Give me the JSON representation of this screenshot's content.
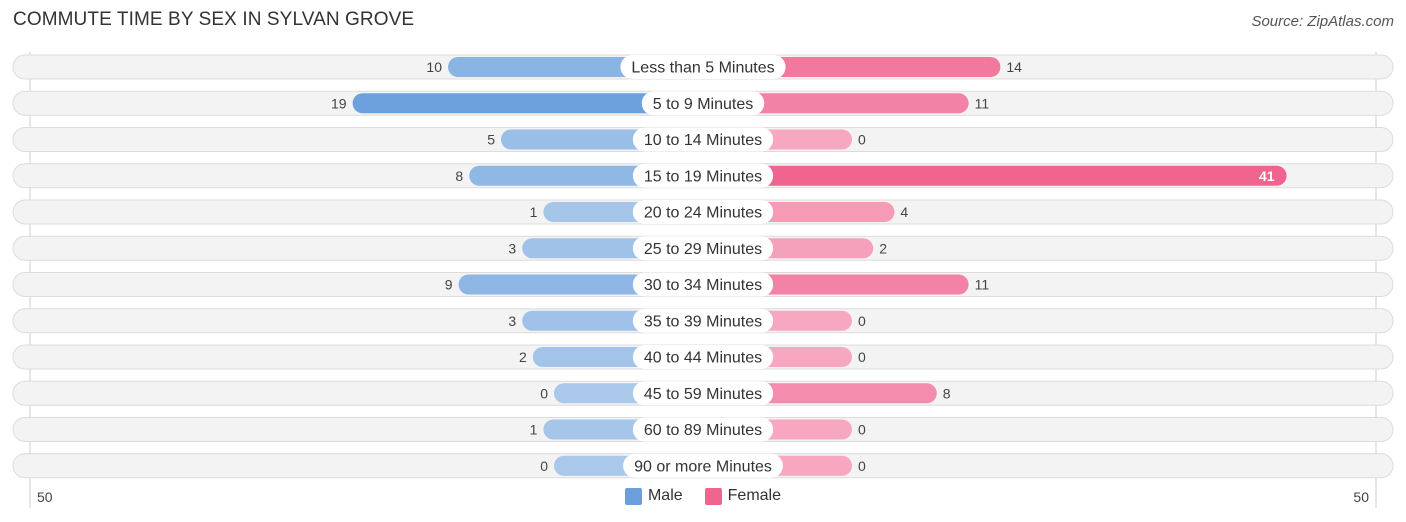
{
  "header": {
    "title": "COMMUTE TIME BY SEX IN SYLVAN GROVE",
    "source": "Source: ZipAtlas.com"
  },
  "colors": {
    "male": "#6a9fdc",
    "male_light": "#a9c8ea",
    "female": "#f06590",
    "female_light": "#f7a8c0"
  },
  "legend": [
    {
      "name": "Male",
      "color": "#6a9fdc"
    },
    {
      "name": "Female",
      "color": "#f06590"
    }
  ],
  "chart_data": {
    "type": "bar",
    "orientation": "horizontal-diverging",
    "title": "COMMUTE TIME BY SEX IN SYLVAN GROVE",
    "categories": [
      "Less than 5 Minutes",
      "5 to 9 Minutes",
      "10 to 14 Minutes",
      "15 to 19 Minutes",
      "20 to 24 Minutes",
      "25 to 29 Minutes",
      "30 to 34 Minutes",
      "35 to 39 Minutes",
      "40 to 44 Minutes",
      "45 to 59 Minutes",
      "60 to 89 Minutes",
      "90 or more Minutes"
    ],
    "series": [
      {
        "name": "Male",
        "values": [
          10,
          19,
          5,
          8,
          1,
          3,
          9,
          3,
          2,
          0,
          1,
          0
        ]
      },
      {
        "name": "Female",
        "values": [
          14,
          11,
          0,
          41,
          4,
          2,
          11,
          0,
          0,
          8,
          0,
          0
        ]
      }
    ],
    "axis": {
      "left_label": "50",
      "right_label": "50",
      "range": [
        0,
        50
      ]
    },
    "legend_position": "bottom-center",
    "grid": false
  }
}
